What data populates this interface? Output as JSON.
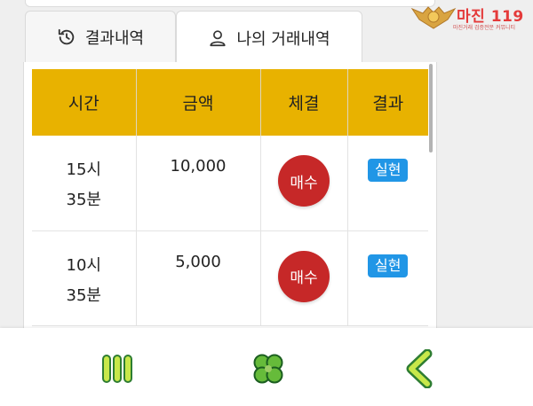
{
  "logo": {
    "title": "마진 119",
    "subtitle": "마진거래 검증전문 커뮤니티"
  },
  "tabs": [
    {
      "label": "결과내역",
      "icon": "history-icon",
      "active": false
    },
    {
      "label": "나의 거래내역",
      "icon": "user-icon",
      "active": true
    }
  ],
  "table": {
    "headers": [
      "시간",
      "금액",
      "체결",
      "결과"
    ],
    "rows": [
      {
        "time_hour": "15시",
        "time_min": "35분",
        "amount": "10,000",
        "trade": "매수",
        "result": "실현"
      },
      {
        "time_hour": "10시",
        "time_min": "35분",
        "amount": "5,000",
        "trade": "매수",
        "result": "실현"
      }
    ]
  },
  "bottom_nav": [
    {
      "name": "menu",
      "icon": "menu-bars-icon"
    },
    {
      "name": "home",
      "icon": "clover-icon"
    },
    {
      "name": "back",
      "icon": "chevron-left-icon"
    }
  ],
  "colors": {
    "header_bg": "#e8b200",
    "buy": "#c62828",
    "result": "#2196e6",
    "nav_accent": "#c8e84a"
  }
}
